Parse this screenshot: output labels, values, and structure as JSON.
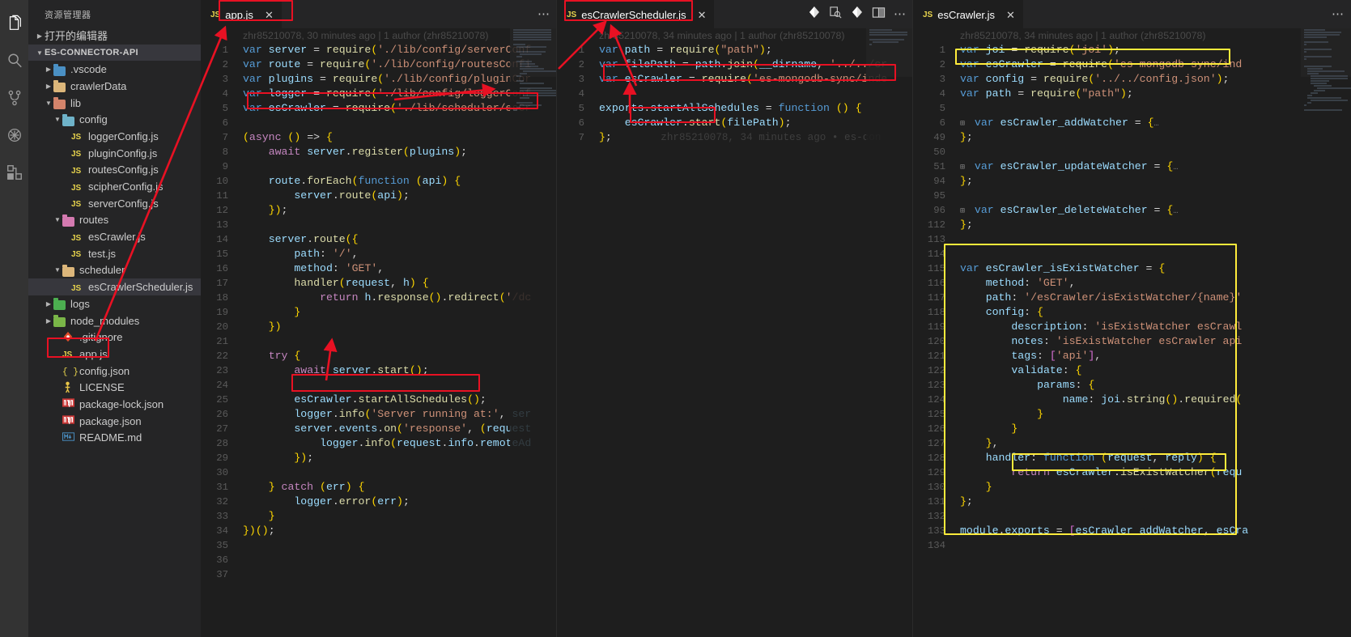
{
  "window": {
    "activity_bar": [
      {
        "name": "explorer-icon",
        "label": "资源管理器"
      },
      {
        "name": "search-icon",
        "label": "搜索"
      },
      {
        "name": "source-control-icon",
        "label": "源代码管理"
      },
      {
        "name": "debug-icon",
        "label": "调试"
      },
      {
        "name": "extensions-icon",
        "label": "扩展"
      }
    ]
  },
  "sidebar": {
    "title": "资源管理器",
    "open_editors_label": "打开的编辑器",
    "root_label": "ES-CONNECTOR-API",
    "items": [
      {
        "label": ".vscode",
        "type": "folder",
        "depth": 2,
        "expanded": false,
        "color": "#4a90c4"
      },
      {
        "label": "crawlerData",
        "type": "folder",
        "depth": 2,
        "expanded": false,
        "color": "#dcb67a"
      },
      {
        "label": "lib",
        "type": "folder",
        "depth": 2,
        "expanded": true,
        "color": "#d4846b"
      },
      {
        "label": "config",
        "type": "folder",
        "depth": 3,
        "expanded": true,
        "color": "#6fb3c9"
      },
      {
        "label": "loggerConfig.js",
        "type": "js",
        "depth": 4
      },
      {
        "label": "pluginConfig.js",
        "type": "js",
        "depth": 4
      },
      {
        "label": "routesConfig.js",
        "type": "js",
        "depth": 4
      },
      {
        "label": "scipherConfig.js",
        "type": "js",
        "depth": 4
      },
      {
        "label": "serverConfig.js",
        "type": "js",
        "depth": 4
      },
      {
        "label": "routes",
        "type": "folder",
        "depth": 3,
        "expanded": true,
        "color": "#d47ab0"
      },
      {
        "label": "esCrawler.js",
        "type": "js",
        "depth": 4
      },
      {
        "label": "test.js",
        "type": "js",
        "depth": 4
      },
      {
        "label": "scheduler",
        "type": "folder",
        "depth": 3,
        "expanded": true,
        "color": "#dcb67a"
      },
      {
        "label": "esCrawlerScheduler.js",
        "type": "js",
        "depth": 4,
        "selected": true
      },
      {
        "label": "logs",
        "type": "folder",
        "depth": 2,
        "expanded": false,
        "color": "#4caf50"
      },
      {
        "label": "node_modules",
        "type": "folder",
        "depth": 2,
        "expanded": false,
        "color": "#7ab648"
      },
      {
        "label": ".gitignore",
        "type": "git",
        "depth": 3
      },
      {
        "label": "app.js",
        "type": "js",
        "depth": 3,
        "highlighted": true
      },
      {
        "label": "config.json",
        "type": "json",
        "depth": 3
      },
      {
        "label": "LICENSE",
        "type": "license",
        "depth": 3
      },
      {
        "label": "package-lock.json",
        "type": "npm",
        "depth": 3
      },
      {
        "label": "package.json",
        "type": "npm",
        "depth": 3
      },
      {
        "label": "README.md",
        "type": "md",
        "depth": 3
      }
    ]
  },
  "editor_groups": [
    {
      "tab": {
        "label": "app.js",
        "icon": "JS",
        "close": "✕",
        "highlighted": true
      },
      "actions": {
        "more": "⋯"
      },
      "blame_header": "zhr85210078, 30 minutes ago | 1 author (zhr85210078)",
      "lines": [
        {
          "n": "1",
          "t": "var server = require('./lib/config/serverConf"
        },
        {
          "n": "2",
          "t": "var route = require('./lib/config/routesConfi"
        },
        {
          "n": "3",
          "t": "var plugins = require('./lib/config/pluginCor"
        },
        {
          "n": "4",
          "t": "var logger = require('./lib/config/loggerConf"
        },
        {
          "n": "5",
          "t": "var esCrawler = require('./lib/scheduler/esCr"
        },
        {
          "n": "6",
          "t": ""
        },
        {
          "n": "7",
          "t": "(async () => {"
        },
        {
          "n": "8",
          "t": "    await server.register(plugins);"
        },
        {
          "n": "9",
          "t": ""
        },
        {
          "n": "10",
          "t": "    route.forEach(function (api) {"
        },
        {
          "n": "11",
          "t": "        server.route(api);"
        },
        {
          "n": "12",
          "t": "    });"
        },
        {
          "n": "13",
          "t": ""
        },
        {
          "n": "14",
          "t": "    server.route({"
        },
        {
          "n": "15",
          "t": "        path: '/',"
        },
        {
          "n": "16",
          "t": "        method: 'GET',"
        },
        {
          "n": "17",
          "t": "        handler(request, h) {"
        },
        {
          "n": "18",
          "t": "            return h.response().redirect('/dc"
        },
        {
          "n": "19",
          "t": "        }"
        },
        {
          "n": "20",
          "t": "    })"
        },
        {
          "n": "21",
          "t": ""
        },
        {
          "n": "22",
          "t": "    try {"
        },
        {
          "n": "23",
          "t": "        await server.start();"
        },
        {
          "n": "24",
          "t": ""
        },
        {
          "n": "25",
          "t": "        esCrawler.startAllSchedules();"
        },
        {
          "n": "26",
          "t": "        logger.info('Server running at:', ser"
        },
        {
          "n": "27",
          "t": "        server.events.on('response', (request"
        },
        {
          "n": "28",
          "t": "            logger.info(request.info.remoteAd"
        },
        {
          "n": "29",
          "t": "        });"
        },
        {
          "n": "30",
          "t": ""
        },
        {
          "n": "31",
          "t": "    } catch (err) {"
        },
        {
          "n": "32",
          "t": "        logger.error(err);"
        },
        {
          "n": "33",
          "t": "    }"
        },
        {
          "n": "34",
          "t": "})();"
        },
        {
          "n": "35",
          "t": ""
        },
        {
          "n": "36",
          "t": ""
        },
        {
          "n": "37",
          "t": ""
        }
      ]
    },
    {
      "tab": {
        "label": "esCrawlerScheduler.js",
        "icon": "JS",
        "close": "✕",
        "highlighted": true
      },
      "actions": {
        "split": "split-editor",
        "more": "⋯"
      },
      "blame_header": "zhr85210078, 34 minutes ago | 1 author (zhr85210078)",
      "inline_blame": "zhr85210078, 34 minutes ago • es-con",
      "lines": [
        {
          "n": "1",
          "t": "var path = require(\"path\");"
        },
        {
          "n": "2",
          "t": "var filePath = path.join(__dirname, '../../cr"
        },
        {
          "n": "3",
          "t": "var esCrawler = require('es-mongodb-sync/inde"
        },
        {
          "n": "4",
          "t": ""
        },
        {
          "n": "5",
          "t": "exports.startAllSchedules = function () {"
        },
        {
          "n": "6",
          "t": "    esCrawler.start(filePath);"
        },
        {
          "n": "7",
          "t": "};"
        }
      ]
    },
    {
      "tab": {
        "label": "esCrawler.js",
        "icon": "JS",
        "close": "✕"
      },
      "actions": {
        "more": "⋯"
      },
      "blame_header": "zhr85210078, 34 minutes ago | 1 author (zhr85210078)",
      "lines": [
        {
          "n": "1",
          "t": "var joi = require('joi');"
        },
        {
          "n": "2",
          "t": "var esCrawler = require('es-mongodb-sync/ind"
        },
        {
          "n": "3",
          "t": "var config = require('../../config.json');"
        },
        {
          "n": "4",
          "t": "var path = require(\"path\");"
        },
        {
          "n": "5",
          "t": ""
        },
        {
          "n": "6",
          "t": "var esCrawler_addWatcher = {…",
          "fold": true
        },
        {
          "n": "49",
          "t": "};"
        },
        {
          "n": "50",
          "t": ""
        },
        {
          "n": "51",
          "t": "var esCrawler_updateWatcher = {…",
          "fold": true
        },
        {
          "n": "94",
          "t": "};"
        },
        {
          "n": "95",
          "t": ""
        },
        {
          "n": "96",
          "t": "var esCrawler_deleteWatcher = {…",
          "fold": true
        },
        {
          "n": "112",
          "t": "};"
        },
        {
          "n": "113",
          "t": ""
        },
        {
          "n": "114",
          "t": ""
        },
        {
          "n": "115",
          "t": "var esCrawler_isExistWatcher = {"
        },
        {
          "n": "116",
          "t": "    method: 'GET',"
        },
        {
          "n": "117",
          "t": "    path: '/esCrawler/isExistWatcher/{name}'"
        },
        {
          "n": "118",
          "t": "    config: {"
        },
        {
          "n": "119",
          "t": "        description: 'isExistWatcher esCrawl"
        },
        {
          "n": "120",
          "t": "        notes: 'isExistWatcher esCrawler api"
        },
        {
          "n": "121",
          "t": "        tags: ['api'],"
        },
        {
          "n": "122",
          "t": "        validate: {"
        },
        {
          "n": "123",
          "t": "            params: {"
        },
        {
          "n": "124",
          "t": "                name: joi.string().required("
        },
        {
          "n": "125",
          "t": "            }"
        },
        {
          "n": "126",
          "t": "        }"
        },
        {
          "n": "127",
          "t": "    },"
        },
        {
          "n": "128",
          "t": "    handler: function (request, reply) {"
        },
        {
          "n": "129",
          "t": "        return esCrawler.isExistWatcher(requ"
        },
        {
          "n": "130",
          "t": "    }"
        },
        {
          "n": "131",
          "t": "};"
        },
        {
          "n": "132",
          "t": ""
        },
        {
          "n": "133",
          "t": "module.exports = [esCrawler_addWatcher, esCra"
        },
        {
          "n": "134",
          "t": ""
        }
      ]
    }
  ],
  "annotations": {
    "red_boxes": [
      {
        "name": "sidebar-app-js-highlight"
      },
      {
        "name": "tab-app-js-highlight"
      },
      {
        "name": "app-js-line5-require-highlight"
      },
      {
        "name": "app-js-line25-startAllSchedules-highlight"
      },
      {
        "name": "tab-escrawlerscheduler-highlight"
      },
      {
        "name": "scheduler-line3-require-highlight"
      },
      {
        "name": "scheduler-line6-start-highlight"
      }
    ],
    "yellow_boxes": [
      {
        "name": "escrawler-line2-require-highlight"
      },
      {
        "name": "escrawler-isexistwatcher-block-highlight"
      },
      {
        "name": "escrawler-line129-return-highlight"
      }
    ],
    "arrows": [
      {
        "name": "arrow-sidebar-to-tab"
      },
      {
        "name": "arrow-line5-to-line4"
      },
      {
        "name": "arrow-line25-to-line24"
      },
      {
        "name": "arrow-scheduler-tab-to-app-tab"
      },
      {
        "name": "arrow-scheduler-line3-up"
      },
      {
        "name": "arrow-scheduler-line6-up"
      }
    ],
    "accent_red": "#e81123",
    "accent_yellow": "#ffeb3b"
  }
}
